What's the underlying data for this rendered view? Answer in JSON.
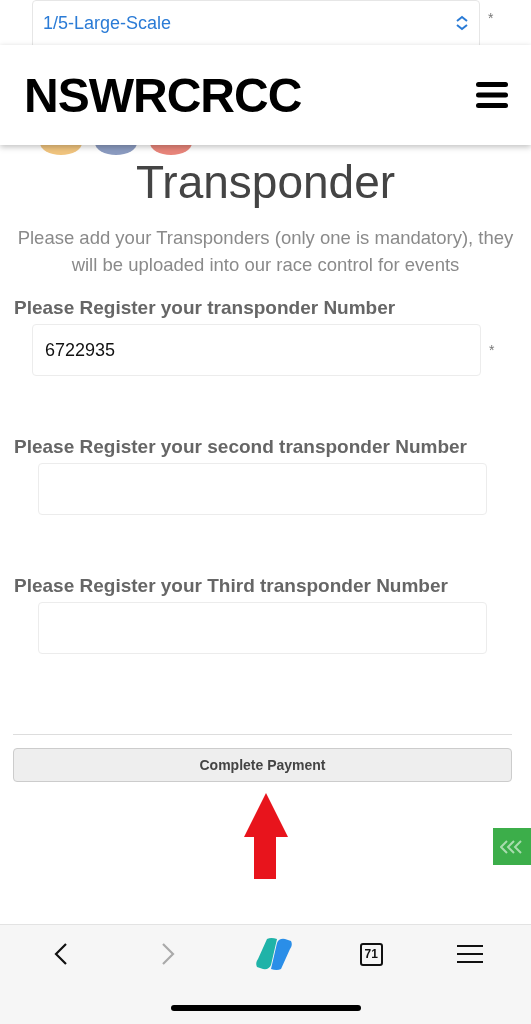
{
  "top_select": {
    "value": "1/5-Large-Scale",
    "required_mark": "*"
  },
  "header": {
    "logo": "NSWRCRCC"
  },
  "title": "Transponder",
  "description": "Please add your Transponders (only one is mandatory), they will be uploaded into our race control for events",
  "fields": [
    {
      "label": "Please Register your transponder Number",
      "value": "6722935",
      "required_mark": "*"
    },
    {
      "label": "Please Register your second transponder Number"
    },
    {
      "label": "Please Register your Third transponder Number"
    }
  ],
  "submit_button": "Complete Payment",
  "browser_toolbar": {
    "back_disabled": false,
    "forward_disabled": true,
    "tab_count": "71"
  }
}
